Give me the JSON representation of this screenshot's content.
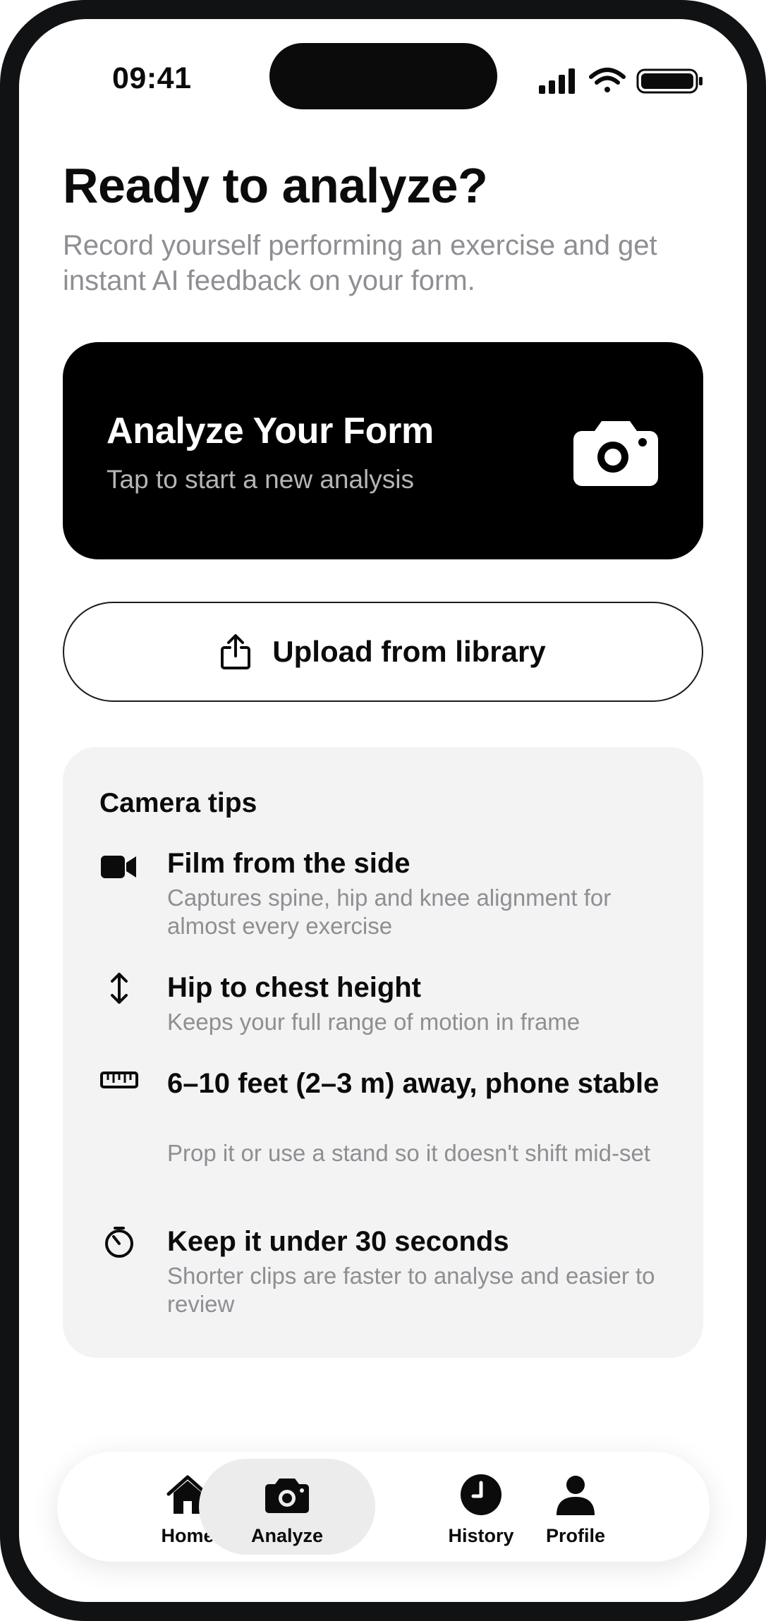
{
  "status_bar": {
    "time": "09:41"
  },
  "header": {
    "title": "Ready to analyze?",
    "subtitle": "Record yourself performing an exercise and get instant AI feedback on your form."
  },
  "analyze_card": {
    "title": "Analyze Your Form",
    "subtitle": "Tap to start a new analysis",
    "icon": "camera-icon"
  },
  "upload": {
    "label": "Upload from library",
    "icon": "share-upload-icon"
  },
  "tips": {
    "title": "Camera tips",
    "items": [
      {
        "icon": "video-camera-icon",
        "title": "Film from the side",
        "body": "Captures spine, hip and knee alignment for almost every exercise"
      },
      {
        "icon": "vertical-arrows-icon",
        "title": "Hip to chest height",
        "body": "Keeps your full range of motion in frame"
      },
      {
        "icon": "ruler-icon",
        "title": "6–10 feet (2–3 m) away, phone stable",
        "body": "Prop it or use a stand so it doesn't shift mid-set"
      },
      {
        "icon": "timer-icon",
        "title": "Keep it under 30 seconds",
        "body": "Shorter clips are faster to analyse and easier to review"
      }
    ]
  },
  "tabbar": {
    "active": "Analyze",
    "items": [
      {
        "label": "Home",
        "icon": "home-icon"
      },
      {
        "label": "Analyze",
        "icon": "camera-icon"
      },
      {
        "label": "History",
        "icon": "clock-icon"
      },
      {
        "label": "Profile",
        "icon": "person-icon"
      }
    ]
  }
}
